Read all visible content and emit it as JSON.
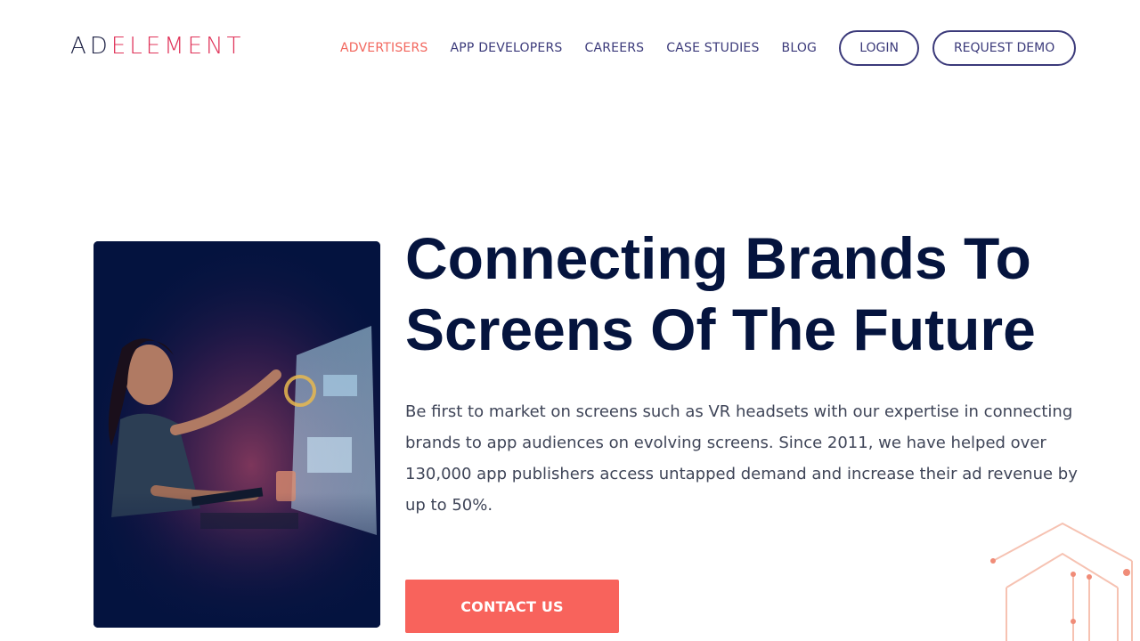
{
  "brand": {
    "logo_part1": "AD",
    "logo_part2": "ELEMENT"
  },
  "nav": {
    "items": [
      {
        "label": "ADVERTISERS",
        "active": true
      },
      {
        "label": "APP DEVELOPERS"
      },
      {
        "label": "CAREERS"
      },
      {
        "label": "CASE STUDIES"
      },
      {
        "label": "BLOG"
      }
    ],
    "login_label": "LOGIN",
    "demo_label": "REQUEST DEMO"
  },
  "hero": {
    "title": "Connecting Brands To Screens Of The Future",
    "description": "Be first to market on screens such as VR headsets with our expertise in connecting brands to app audiences on evolving screens. Since 2011, we have helped over 130,000 app publishers access untapped demand and increase their ad revenue by up to 50%.",
    "cta_label": "CONTACT US",
    "image_icon": "woman-touching-holographic-screen-image"
  },
  "colors": {
    "accent": "#f8635c",
    "nav": "#3b3a7a",
    "title": "#05143e",
    "logo_dark": "#1e2245",
    "logo_red": "#e0345a"
  }
}
